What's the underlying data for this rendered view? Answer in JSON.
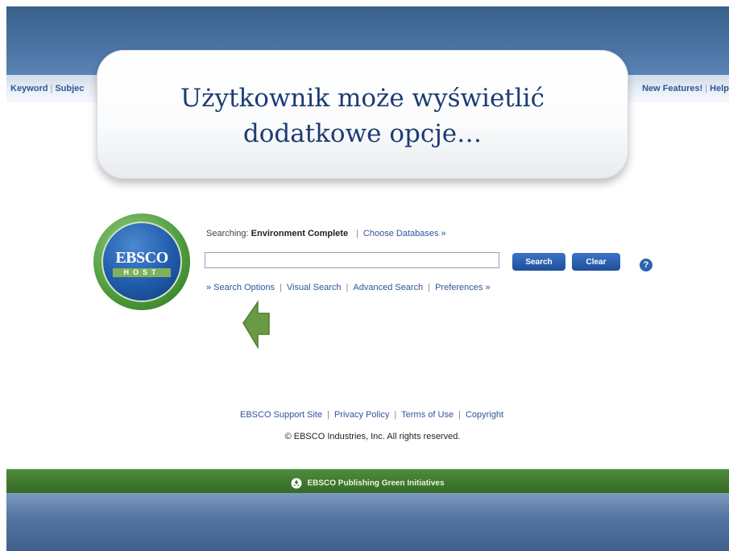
{
  "nav": {
    "left": [
      "Keyword",
      "Subjec"
    ],
    "right": [
      "New Features!",
      "Help"
    ]
  },
  "callout": {
    "line1": "Użytkownik może wyświetlić",
    "line2": "dodatkowe opcje…"
  },
  "logo": {
    "word": "EBSCO",
    "sub": "HOST"
  },
  "search": {
    "searching_label": "Searching:",
    "database": "Environment Complete",
    "choose_databases": "Choose Databases »",
    "input_value": "",
    "search_button": "Search",
    "clear_button": "Clear",
    "help": "?"
  },
  "options": {
    "search_options": "» Search Options",
    "visual_search": "Visual Search",
    "advanced_search": "Advanced Search",
    "preferences": "Preferences »"
  },
  "footer": {
    "support": "EBSCO Support Site",
    "privacy": "Privacy Policy",
    "terms": "Terms of Use",
    "copyright_link": "Copyright",
    "copyright_text": "© EBSCO Industries, Inc. All rights reserved."
  },
  "green_bar": {
    "label": "EBSCO Publishing Green Initiatives"
  },
  "colors": {
    "accent_blue": "#2f5597",
    "green_bar": "#3f7a2e",
    "arrow_green": "#6a9a43",
    "callout_text": "#1d3c73"
  }
}
